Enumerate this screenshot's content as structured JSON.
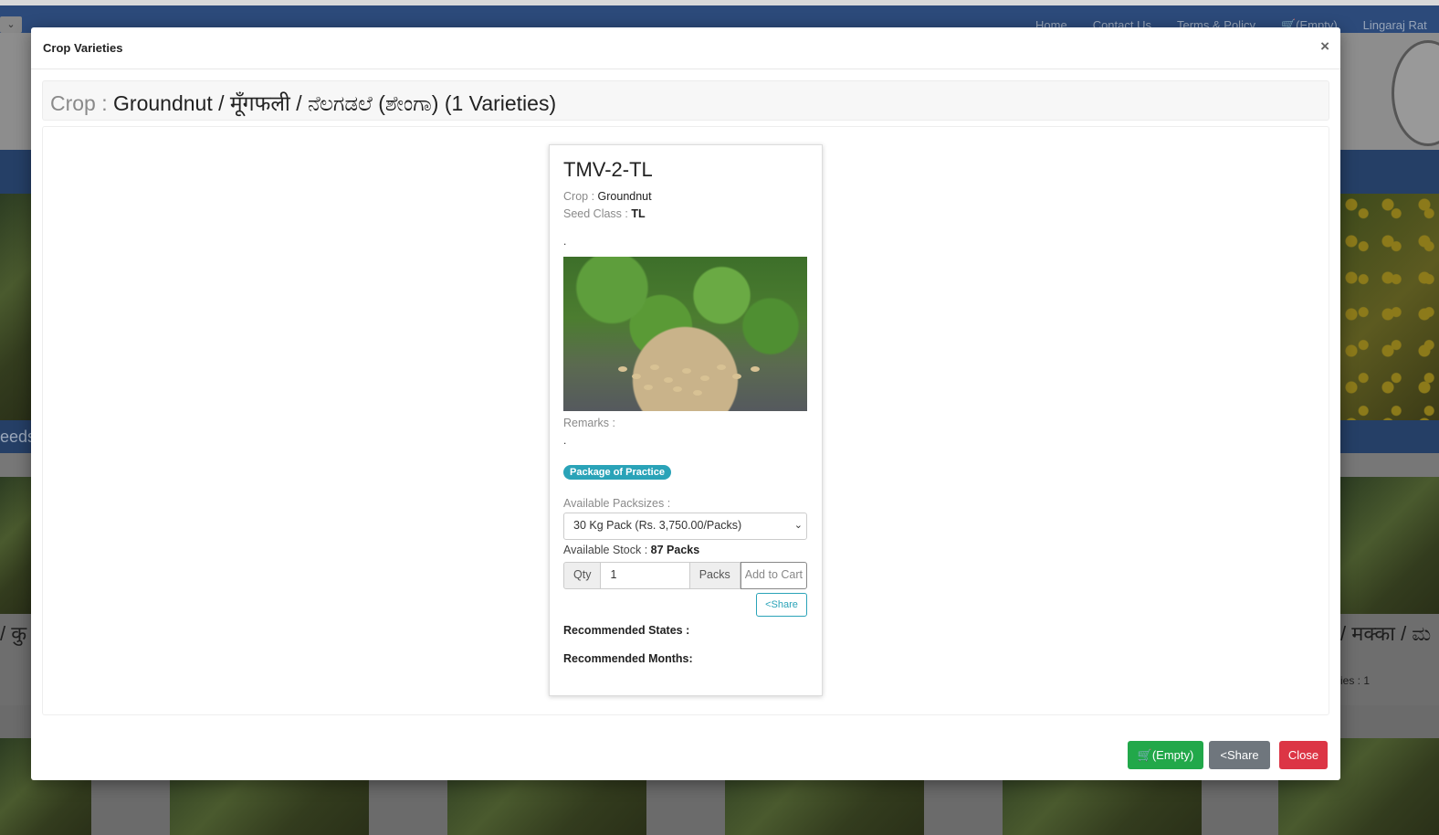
{
  "background": {
    "nav": [
      "Home",
      "Contact Us",
      "Terms & Policy",
      "(Empty)",
      "Lingaraj Rat"
    ],
    "left_text_1": "eeds",
    "left_text_2": "/ कु",
    "right_text_1": "/ मक्का / ಮ",
    "right_text_2": "ies : 1"
  },
  "modal": {
    "title": "Crop Varieties",
    "close_x": "×",
    "heading_label": "Crop :",
    "heading_value": "Groundnut / मूँगफली / ನೆಲಗಡಲೆ (ಶೇಂಗಾ) (1 Varieties)"
  },
  "variety": {
    "name": "TMV-2-TL",
    "crop_label": "Crop :",
    "crop_value": "Groundnut",
    "seed_class_label": "Seed Class :",
    "seed_class_value": "TL",
    "description": ".",
    "remarks_label": "Remarks :",
    "remarks_value": ".",
    "badge": "Package of Practice",
    "packsizes_label": "Available Packsizes :",
    "packsize_selected": "30 Kg Pack (Rs. 3,750.00/Packs)",
    "stock_label": "Available Stock :",
    "stock_value": "87 Packs",
    "qty_label": "Qty",
    "qty_value": "1",
    "packs_label": "Packs",
    "add_to_cart": "Add to Cart",
    "share": "Share",
    "recommended_states": "Recommended States :",
    "recommended_months": "Recommended Months:"
  },
  "footer": {
    "cart": "(Empty)",
    "share": "Share",
    "close": "Close"
  },
  "colors": {
    "nav": "#2c4a7a",
    "badge": "#2aa3b8",
    "cart_button": "#22a84a",
    "share_button": "#6f767d",
    "close_button": "#dc3545"
  }
}
